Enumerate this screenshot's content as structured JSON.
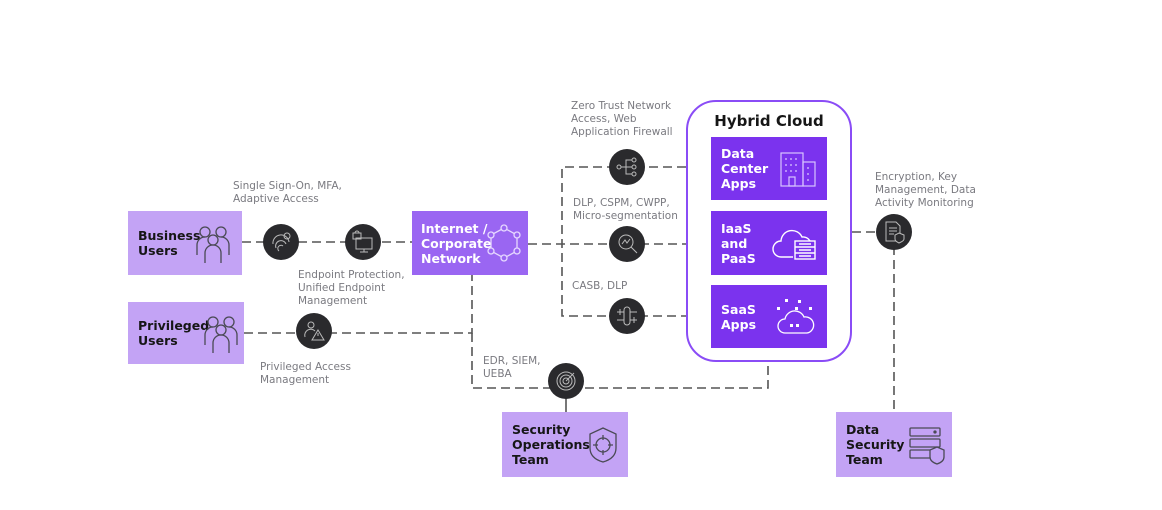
{
  "colors": {
    "light_box": "#c3a3f5",
    "network_box": "#9a66f2",
    "cloud_box": "#7b33ee",
    "cloud_border": "#8a4cf6",
    "control_circle": "#2a2a2d",
    "line": "#555555",
    "label": "#7a7a80"
  },
  "actors": {
    "business_users": {
      "label": "Business\nUsers",
      "icon": "people-icon"
    },
    "privileged_users": {
      "label": "Privileged\nUsers",
      "icon": "people-icon"
    },
    "network": {
      "label": "Internet /\nCorporate\nNetwork",
      "icon": "network-ring-icon"
    },
    "soc_team": {
      "label": "Security\nOperations\nTeam",
      "icon": "shield-target-icon"
    },
    "data_security_team": {
      "label": "Data\nSecurity\nTeam",
      "icon": "server-shield-icon"
    }
  },
  "hybrid_cloud": {
    "title": "Hybrid Cloud",
    "items": [
      {
        "label": "Data\nCenter\nApps",
        "icon": "buildings-icon"
      },
      {
        "label": "IaaS\nand\nPaaS",
        "icon": "cloud-server-icon"
      },
      {
        "label": "SaaS\nApps",
        "icon": "cloud-apps-icon"
      }
    ]
  },
  "controls": {
    "sso": {
      "label": "Single Sign-On, MFA,\nAdaptive Access",
      "icon": "fingerprint-icon"
    },
    "endpoint": {
      "label": "Endpoint Protection,\nUnified Endpoint\nManagement",
      "icon": "endpoint-lock-icon"
    },
    "pam": {
      "label": "Privileged Access\nManagement",
      "icon": "user-warning-icon"
    },
    "ztna": {
      "label": "Zero Trust Network\nAccess, Web\nApplication Firewall",
      "icon": "network-branch-icon"
    },
    "dlp_cspm": {
      "label": "DLP, CSPM, CWPP,\nMicro-segmentation",
      "icon": "analytics-search-icon"
    },
    "casb": {
      "label": "CASB, DLP",
      "icon": "broker-icon"
    },
    "encryption": {
      "label": "Encryption, Key\nManagement, Data\nActivity Monitoring",
      "icon": "document-shield-icon"
    },
    "edr": {
      "label": "EDR, SIEM,\nUEBA",
      "icon": "radar-icon"
    }
  }
}
